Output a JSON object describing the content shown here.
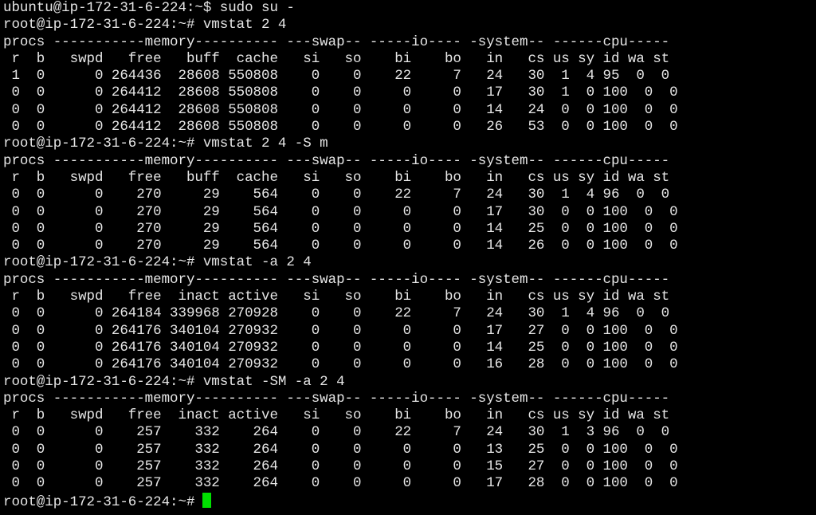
{
  "terminal": {
    "cursor_color": "#00e000",
    "text_color": "#e6e6e6",
    "background": "#000000",
    "lines": [
      "ubuntu@ip-172-31-6-224:~$ sudo su -",
      "root@ip-172-31-6-224:~# vmstat 2 4",
      "procs -----------memory---------- ---swap-- -----io---- -system-- ------cpu-----",
      " r  b   swpd   free   buff  cache   si   so    bi    bo   in   cs us sy id wa st",
      " 1  0      0 264436  28608 550808    0    0    22     7   24   30  1  4 95  0  0",
      " 0  0      0 264412  28608 550808    0    0     0     0   17   30  1  0 100  0  0",
      " 0  0      0 264412  28608 550808    0    0     0     0   14   24  0  0 100  0  0",
      " 0  0      0 264412  28608 550808    0    0     0     0   26   53  0  0 100  0  0",
      "root@ip-172-31-6-224:~# vmstat 2 4 -S m",
      "procs -----------memory---------- ---swap-- -----io---- -system-- ------cpu-----",
      " r  b   swpd   free   buff  cache   si   so    bi    bo   in   cs us sy id wa st",
      " 0  0      0    270     29    564    0    0    22     7   24   30  1  4 96  0  0",
      " 0  0      0    270     29    564    0    0     0     0   17   30  0  0 100  0  0",
      " 0  0      0    270     29    564    0    0     0     0   14   25  0  0 100  0  0",
      " 0  0      0    270     29    564    0    0     0     0   14   26  0  0 100  0  0",
      "root@ip-172-31-6-224:~# vmstat -a 2 4",
      "procs -----------memory---------- ---swap-- -----io---- -system-- ------cpu-----",
      " r  b   swpd   free  inact active   si   so    bi    bo   in   cs us sy id wa st",
      " 0  0      0 264184 339968 270928    0    0    22     7   24   30  1  4 96  0  0",
      " 0  0      0 264176 340104 270932    0    0     0     0   17   27  0  0 100  0  0",
      " 0  0      0 264176 340104 270932    0    0     0     0   14   25  0  0 100  0  0",
      " 0  0      0 264176 340104 270932    0    0     0     0   16   28  0  0 100  0  0",
      "root@ip-172-31-6-224:~# vmstat -SM -a 2 4",
      "procs -----------memory---------- ---swap-- -----io---- -system-- ------cpu-----",
      " r  b   swpd   free  inact active   si   so    bi    bo   in   cs us sy id wa st",
      " 0  0      0    257    332    264    0    0    22     7   24   30  1  3 96  0  0",
      " 0  0      0    257    332    264    0    0     0     0   13   25  0  0 100  0  0",
      " 0  0      0    257    332    264    0    0     0     0   15   27  0  0 100  0  0",
      " 0  0      0    257    332    264    0    0     0     0   17   28  0  0 100  0  0"
    ],
    "prompt": "root@ip-172-31-6-224:~#"
  }
}
